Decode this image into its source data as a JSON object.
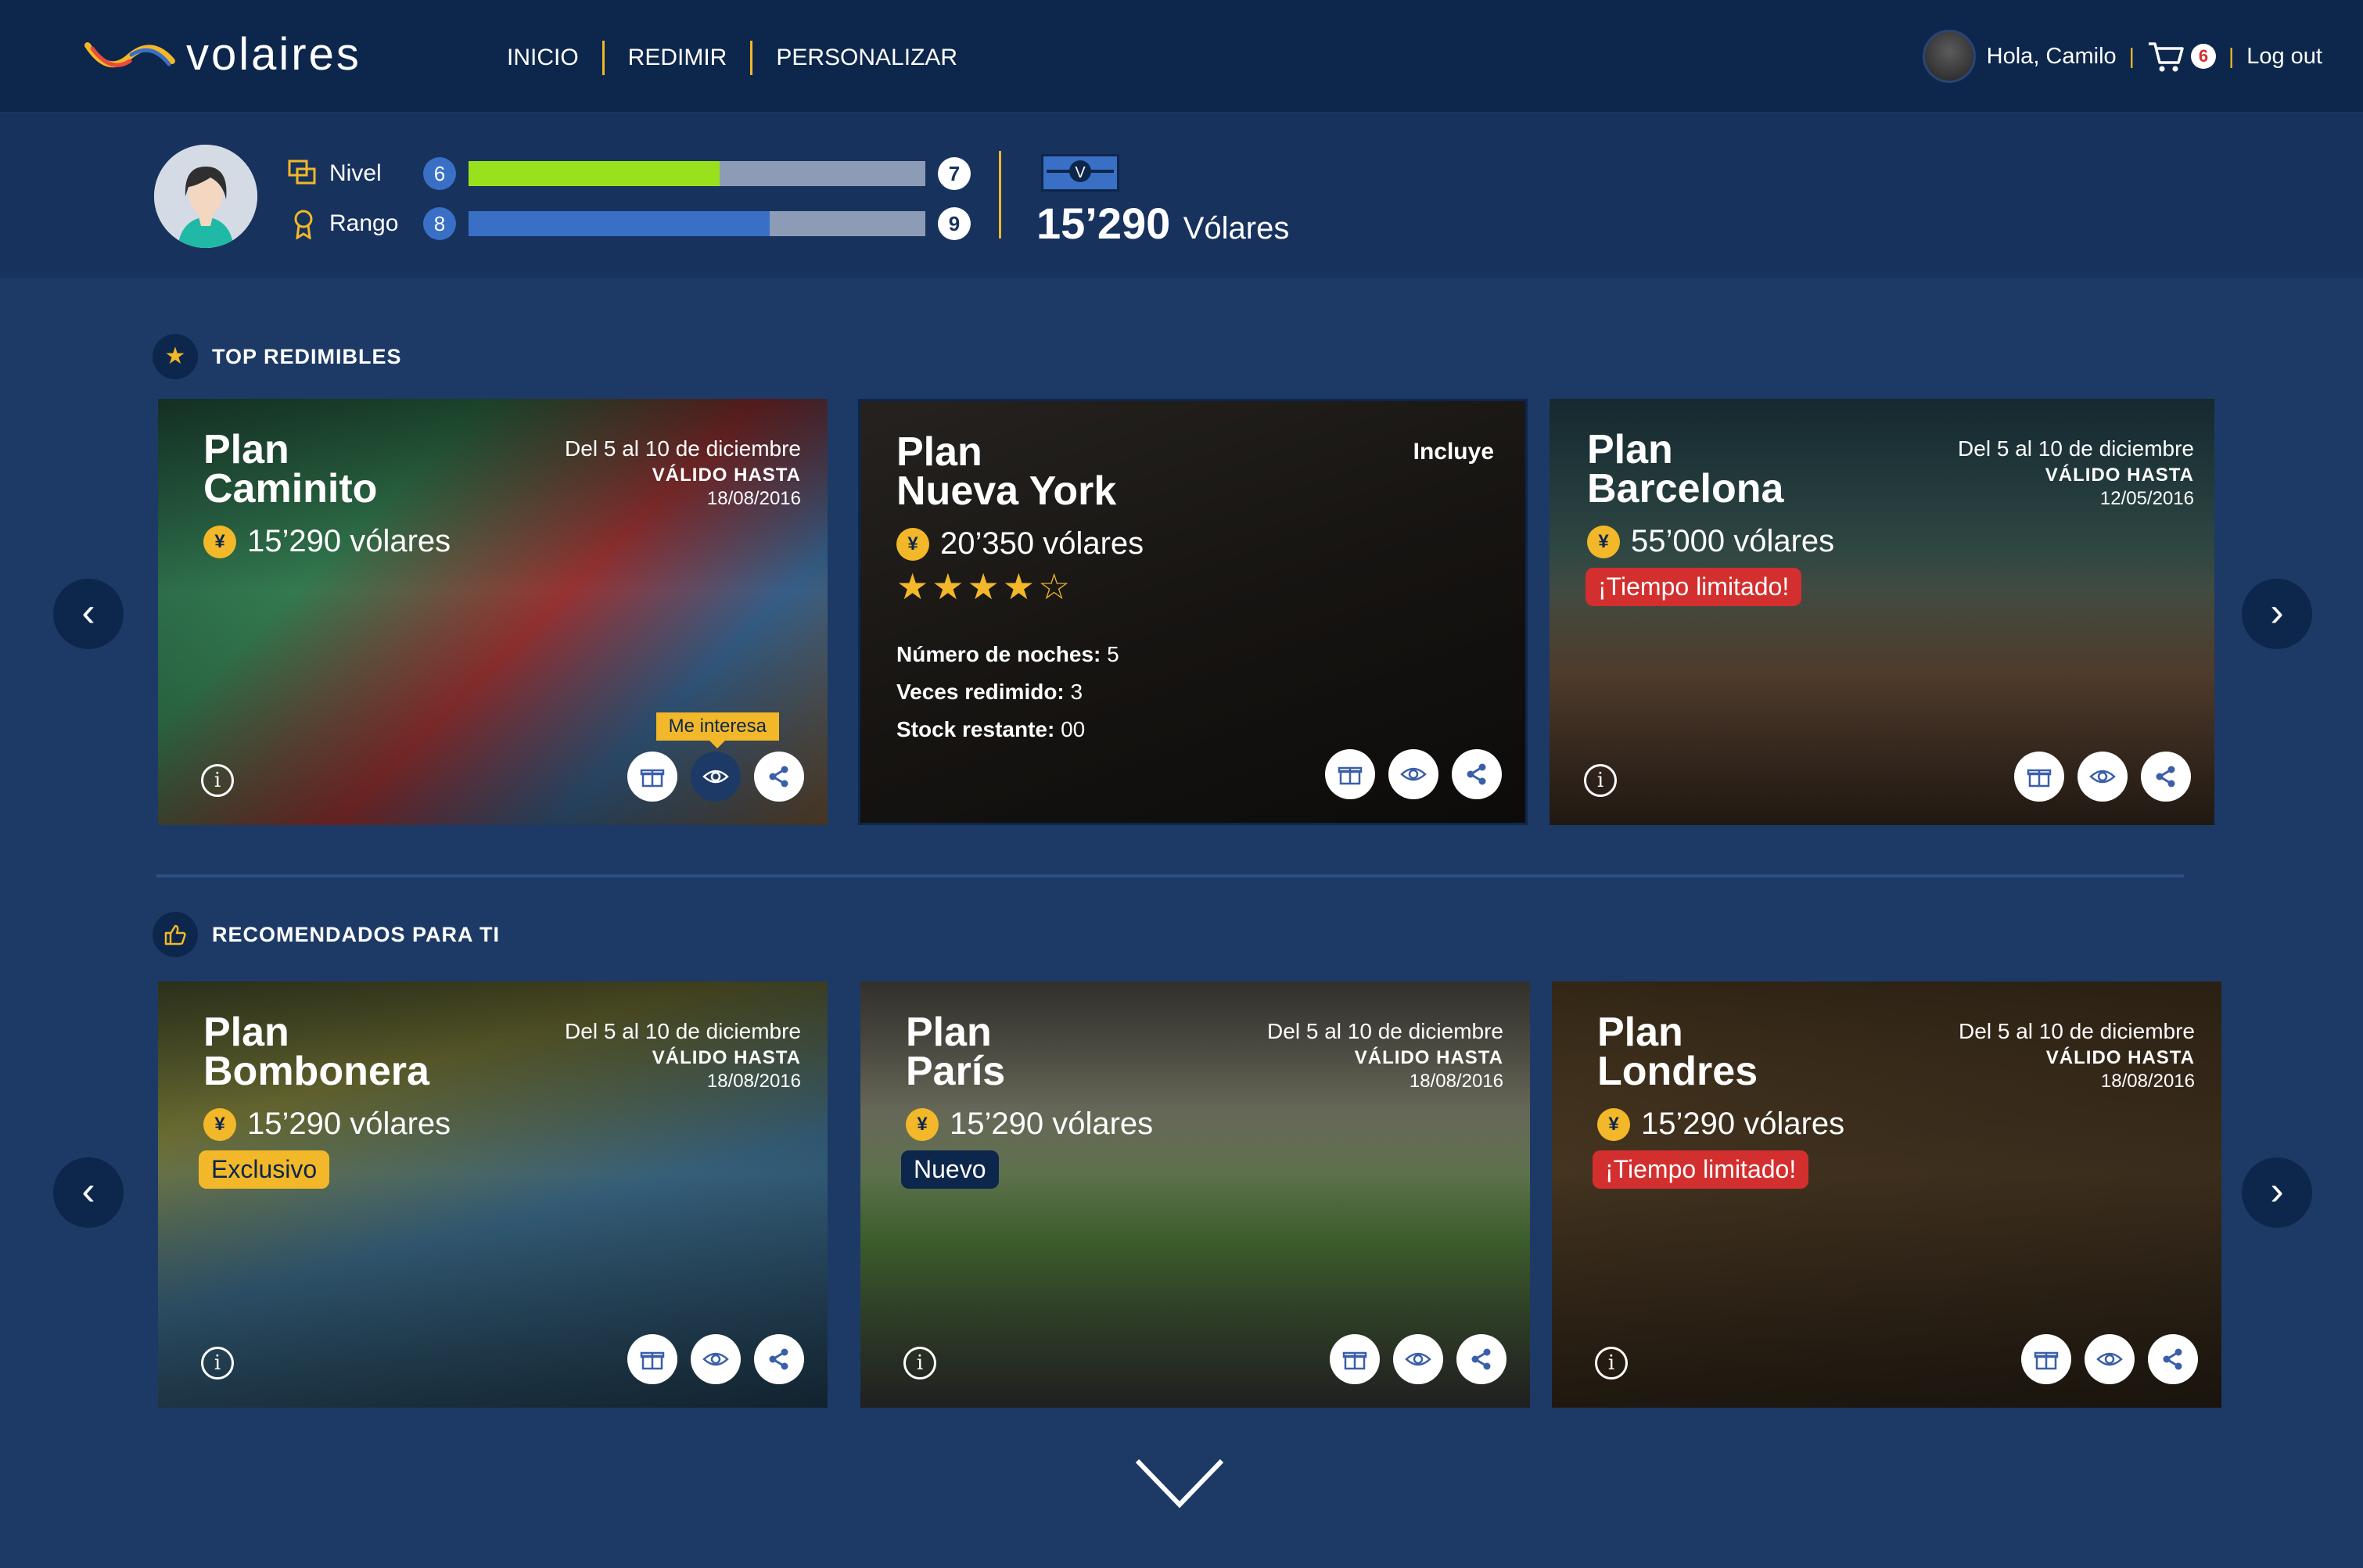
{
  "header": {
    "logo_text": "volaires",
    "nav": [
      "INICIO",
      "REDIMIR",
      "PERSONALIZAR"
    ],
    "greeting": "Hola, Camilo",
    "cart_count": "6",
    "logout": "Log out",
    "separator": "|"
  },
  "profile": {
    "nivel": {
      "label": "Nivel",
      "current": "6",
      "next": "7",
      "progress": 0.55
    },
    "rango": {
      "label": "Rango",
      "current": "8",
      "next": "9",
      "progress": 0.66
    },
    "points_value": "15’290",
    "points_unit": "Vólares",
    "points_icon_letter": "V"
  },
  "colors": {
    "nivel_fill": "#9ae11d",
    "rango_fill": "#3a6fc6",
    "accent": "#f2b829",
    "badge_red": "#d32f2f"
  },
  "sections": {
    "top": {
      "title": "TOP REDIMIBLES",
      "icon": "star-icon"
    },
    "recommended": {
      "title": "RECOMENDADOS PARA TI",
      "icon": "thumbs-up-icon"
    }
  },
  "cards_top": [
    {
      "title_1": "Plan",
      "title_2": "Caminito",
      "price": "15’290 vólares",
      "date": "Del 5 al 10 de diciembre",
      "valid_label": "VÁLIDO HASTA",
      "valid_date": "18/08/2016",
      "tooltip": "Me interesa"
    },
    {
      "title_1": "Plan",
      "title_2": "Nueva York",
      "price": "20’350 vólares",
      "includes": "Incluye",
      "rating": 4,
      "specs": [
        {
          "label": "Número de noches:",
          "value": "5"
        },
        {
          "label": "Veces redimido:",
          "value": "3"
        },
        {
          "label": "Stock restante:",
          "value": "00"
        }
      ]
    },
    {
      "title_1": "Plan",
      "title_2": "Barcelona",
      "price": "55’000 vólares",
      "date": "Del 5 al 10 de diciembre",
      "valid_label": "VÁLIDO HASTA",
      "valid_date": "12/05/2016",
      "badge": "¡Tiempo limitado!"
    }
  ],
  "cards_recommended": [
    {
      "title_1": "Plan",
      "title_2": "Bombonera",
      "price": "15’290 vólares",
      "date": "Del 5 al 10 de diciembre",
      "valid_label": "VÁLIDO HASTA",
      "valid_date": "18/08/2016",
      "badge": "Exclusivo"
    },
    {
      "title_1": "Plan",
      "title_2": "París",
      "price": "15’290 vólares",
      "date": "Del 5 al 10 de diciembre",
      "valid_label": "VÁLIDO HASTA",
      "valid_date": "18/08/2016",
      "badge": "Nuevo"
    },
    {
      "title_1": "Plan",
      "title_2": "Londres",
      "price": "15’290 vólares",
      "date": "Del 5 al 10 de diciembre",
      "valid_label": "VÁLIDO HASTA",
      "valid_date": "18/08/2016",
      "badge": "¡Tiempo limitado!"
    }
  ],
  "icons": {
    "coin": "¥",
    "info": "i",
    "prev": "‹",
    "next": "›"
  }
}
